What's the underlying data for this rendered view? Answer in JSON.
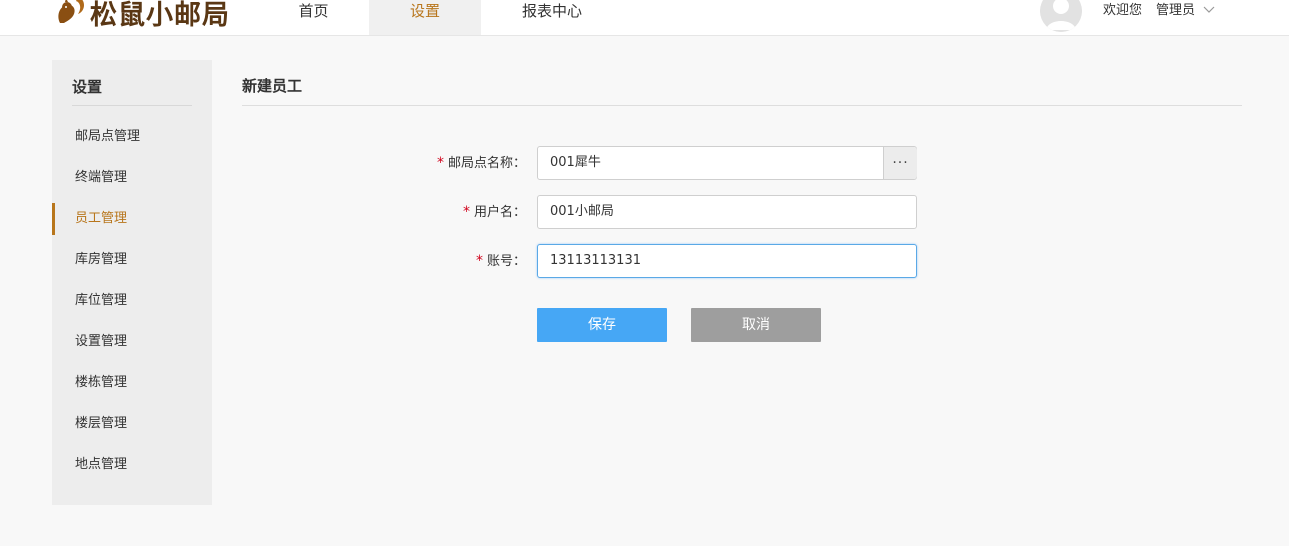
{
  "app": {
    "logo_text": "松鼠小邮局"
  },
  "nav": {
    "items": [
      {
        "label": "首页"
      },
      {
        "label": "设置"
      },
      {
        "label": "报表中心"
      }
    ],
    "active": "设置"
  },
  "user": {
    "welcome": "欢迎您",
    "name": "管理员"
  },
  "sidebar": {
    "title": "设置",
    "items": [
      {
        "label": "邮局点管理"
      },
      {
        "label": "终端管理"
      },
      {
        "label": "员工管理"
      },
      {
        "label": "库房管理"
      },
      {
        "label": "库位管理"
      },
      {
        "label": "设置管理"
      },
      {
        "label": "楼栋管理"
      },
      {
        "label": "楼层管理"
      },
      {
        "label": "地点管理"
      }
    ],
    "active": "员工管理"
  },
  "form": {
    "title": "新建员工",
    "required_mark": "*",
    "fields": [
      {
        "label": "邮局点名称：",
        "value": "001犀牛"
      },
      {
        "label": "用户名：",
        "value": "001小邮局"
      },
      {
        "label": "账号：",
        "value": "13113113131"
      }
    ],
    "picker_label": "···",
    "save_label": "保存",
    "cancel_label": "取消"
  },
  "colors": {
    "accent": "#b8761c",
    "brand": "#5a3714",
    "primary_button": "#46a7f5",
    "secondary_button": "#9e9e9e",
    "required": "#d0021b"
  }
}
